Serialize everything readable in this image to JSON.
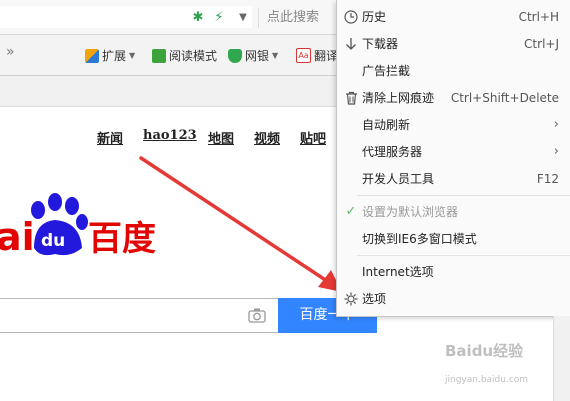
{
  "search": {
    "placeholder": "点此搜索"
  },
  "toolbar": {
    "overflow": "»",
    "items": [
      {
        "label": "扩展"
      },
      {
        "label": "阅读模式"
      },
      {
        "label": "网银"
      },
      {
        "label": "翻译"
      }
    ]
  },
  "page": {
    "nav": [
      "新闻",
      "hao123",
      "地图",
      "视频",
      "贴吧"
    ],
    "logo_text": "ai",
    "logo_du": "du",
    "logo_cn": "百度",
    "search_button": "百度一下"
  },
  "menu": {
    "items": [
      {
        "label": "历史",
        "shortcut": "Ctrl+H",
        "icon": "clock-icon"
      },
      {
        "label": "下载器",
        "shortcut": "Ctrl+J",
        "icon": "download-arrow-icon"
      },
      {
        "label": "广告拦截",
        "shortcut": ""
      },
      {
        "label": "清除上网痕迹",
        "shortcut": "Ctrl+Shift+Delete",
        "icon": "trash-icon"
      },
      {
        "label": "自动刷新",
        "shortcut": "",
        "submenu": true
      },
      {
        "label": "代理服务器",
        "shortcut": "",
        "submenu": true
      },
      {
        "label": "开发人员工具",
        "shortcut": "F12"
      },
      {
        "label": "设置为默认浏览器",
        "shortcut": "",
        "icon": "check-icon",
        "disabled": true
      },
      {
        "label": "切换到IE6多窗口模式",
        "shortcut": ""
      },
      {
        "label": "Internet选项",
        "shortcut": ""
      },
      {
        "label": "选项",
        "shortcut": "",
        "icon": "gear-icon"
      }
    ]
  },
  "watermark": {
    "line1": "Baidu经验",
    "line2": "jingyan.baidu.com"
  },
  "colors": {
    "baidu_red": "#e10601",
    "baidu_blue": "#2319dc",
    "button_blue": "#3385ff",
    "arrow_red": "#e53935"
  }
}
